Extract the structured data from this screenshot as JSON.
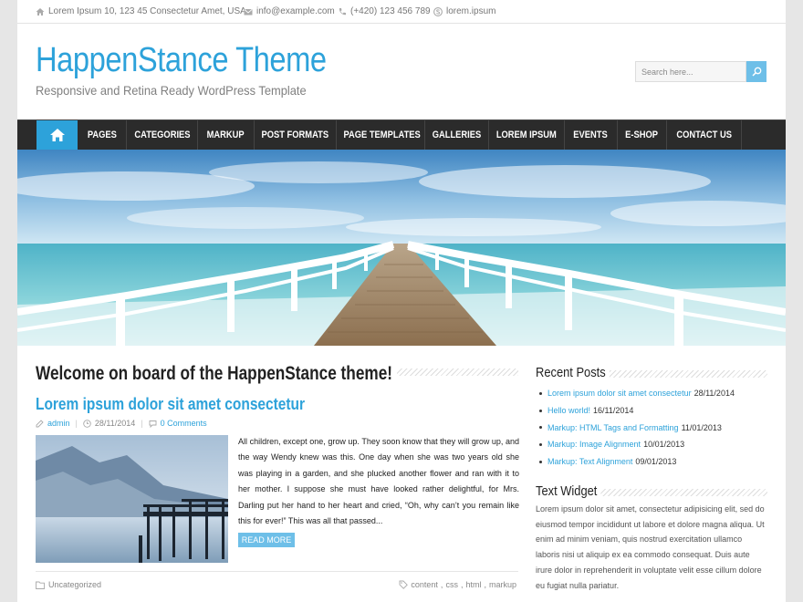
{
  "topbar": {
    "address": "Lorem Ipsum 10, 123 45 Consectetur Amet, USA",
    "email": "info@example.com",
    "phone": "(+420) 123 456 789",
    "skype": "lorem.ipsum",
    "icons": [
      "home-icon",
      "envelope-icon",
      "phone-icon",
      "skype-icon"
    ]
  },
  "header": {
    "title": "HappenStance Theme",
    "description": "Responsive and Retina Ready WordPress Template"
  },
  "search": {
    "placeholder": "Search here..."
  },
  "nav": {
    "items": [
      {
        "label": "PAGES"
      },
      {
        "label": "CATEGORIES"
      },
      {
        "label": "MARKUP"
      },
      {
        "label": "POST FORMATS"
      },
      {
        "label": "PAGE TEMPLATES"
      },
      {
        "label": "GALLERIES"
      },
      {
        "label": "LOREM IPSUM"
      },
      {
        "label": "EVENTS"
      },
      {
        "label": "E-SHOP"
      },
      {
        "label": "CONTACT US"
      }
    ]
  },
  "main": {
    "welcome": "Welcome on board of the HappenStance theme!",
    "post": {
      "title": "Lorem ipsum dolor sit amet consectetur",
      "author": "admin",
      "date": "28/11/2014",
      "comments": "0 Comments",
      "excerpt": "All children, except one, grow up. They soon know that they will grow up, and the way Wendy knew was this. One day when she was two years old she was playing in a garden, and she plucked another flower and ran with it to her mother. I suppose she must have looked rather delightful, for Mrs. Darling put her hand to her heart and cried, “Oh, why can’t you remain like this for ever!” This was all that passed...",
      "read_more": "READ MORE",
      "category": "Uncategorized",
      "tags": [
        "content",
        "css",
        "html",
        "markup"
      ]
    }
  },
  "sidebar": {
    "recent_title": "Recent Posts",
    "recent": [
      {
        "title": "Lorem ipsum dolor sit amet consectetur",
        "date": "28/11/2014"
      },
      {
        "title": "Hello world!",
        "date": "16/11/2014"
      },
      {
        "title": "Markup: HTML Tags and Formatting",
        "date": "11/01/2013"
      },
      {
        "title": "Markup: Image Alignment",
        "date": "10/01/2013"
      },
      {
        "title": "Markup: Text Alignment",
        "date": "09/01/2013"
      }
    ],
    "text_title": "Text Widget",
    "text_body": "Lorem ipsum dolor sit amet, consectetur adipisicing elit, sed do eiusmod tempor incididunt ut labore et dolore magna aliqua. Ut enim ad minim veniam, quis nostrud exercitation ullamco laboris nisi ut aliquip ex ea commodo consequat. Duis aute irure dolor in reprehenderit in voluptate velit esse cillum dolore eu fugiat nulla pariatur."
  },
  "colors": {
    "accent": "#2da2da",
    "nav_bg": "#2b2b2b",
    "button": "#6ebfe8"
  }
}
